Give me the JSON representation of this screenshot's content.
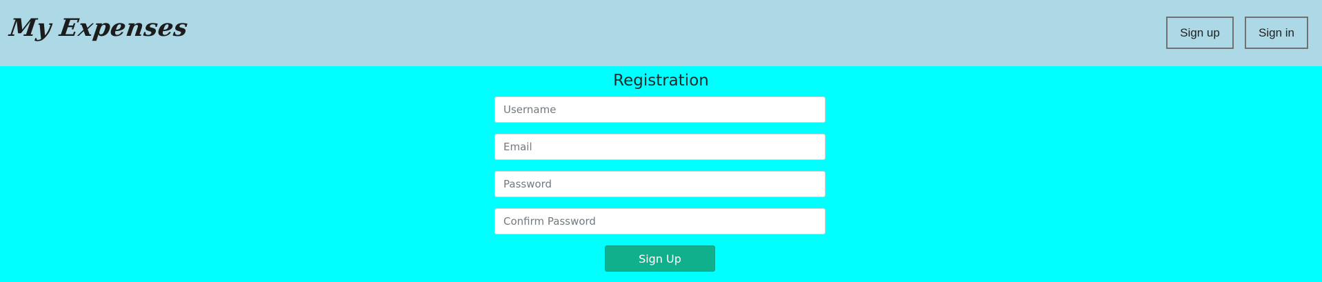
{
  "header": {
    "brand": "My Expenses",
    "background_color": "#add8e6",
    "nav": {
      "signup_label": "Sign up",
      "signin_label": "Sign in"
    }
  },
  "main": {
    "background_color": "#00ffff",
    "title": "Registration",
    "fields": {
      "username": {
        "placeholder": "Username",
        "value": ""
      },
      "email": {
        "placeholder": "Email",
        "value": ""
      },
      "password": {
        "placeholder": "Password",
        "value": ""
      },
      "confirm_password": {
        "placeholder": "Confirm Password",
        "value": ""
      }
    },
    "submit_label": "Sign Up",
    "submit_color": "#10b08c"
  }
}
